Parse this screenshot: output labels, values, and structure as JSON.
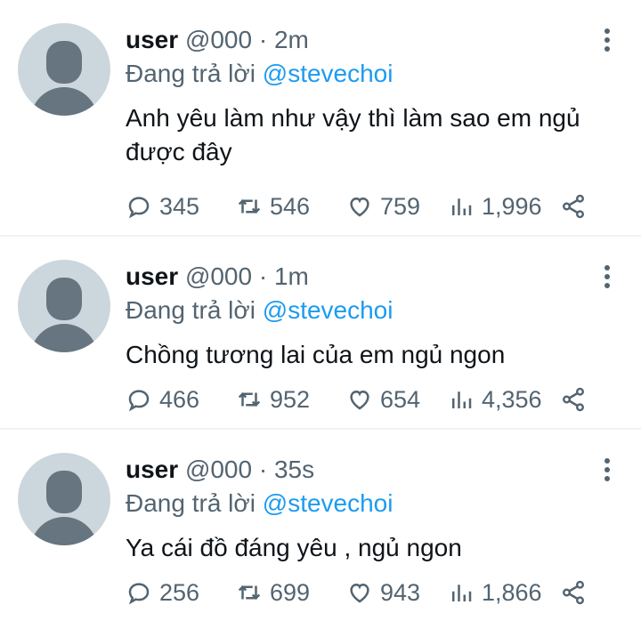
{
  "tweets": [
    {
      "name": "user",
      "handle": "@000",
      "dot": "·",
      "time": "2m",
      "reply_prefix": "Đang trả lời",
      "reply_to": "@stevechoi",
      "text": "Anh yêu làm như vậy thì làm sao em ngủ được đây",
      "replies": "345",
      "retweets": "546",
      "likes": "759",
      "views": "1,996"
    },
    {
      "name": "user",
      "handle": "@000",
      "dot": "·",
      "time": "1m",
      "reply_prefix": "Đang trả lời",
      "reply_to": "@stevechoi",
      "text": "Chồng tương lai của em ngủ ngon",
      "replies": "466",
      "retweets": "952",
      "likes": "654",
      "views": "4,356"
    },
    {
      "name": "user",
      "handle": "@000",
      "dot": "·",
      "time": "35s",
      "reply_prefix": "Đang trả lời",
      "reply_to": "@stevechoi",
      "text": "Ya cái đồ đáng yêu , ngủ ngon",
      "replies": "256",
      "retweets": "699",
      "likes": "943",
      "views": "1,866"
    }
  ],
  "colors": {
    "text": "#0f1419",
    "muted": "#536471",
    "accent": "#1d9bf0",
    "avatar_bg": "#ccd6dd",
    "avatar_fg": "#66757f",
    "divider": "#eff3f4"
  },
  "icons": [
    "more-vertical-icon",
    "reply-icon",
    "retweet-icon",
    "like-icon",
    "views-icon",
    "share-icon",
    "avatar-placeholder-icon"
  ]
}
